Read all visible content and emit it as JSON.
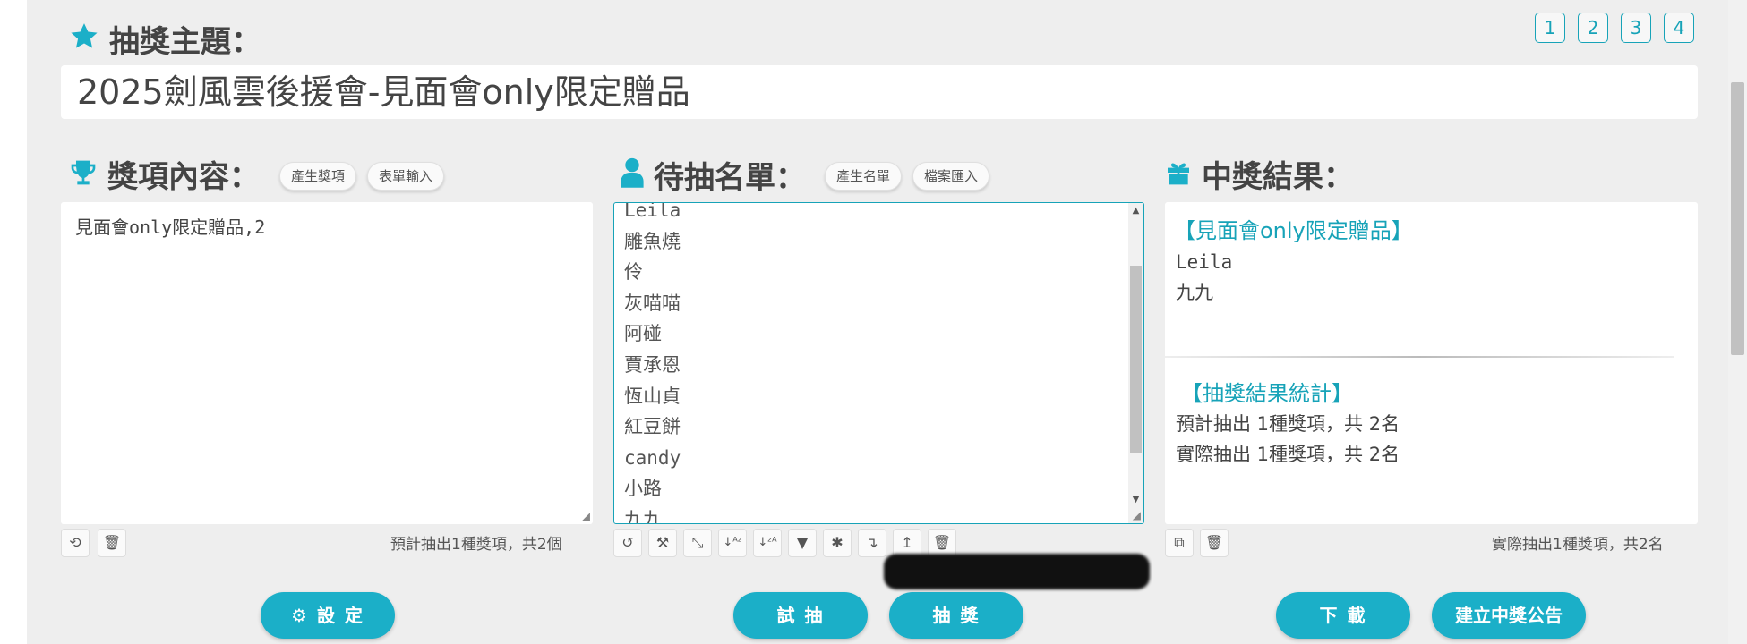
{
  "page_buttons": [
    "1",
    "2",
    "3",
    "4"
  ],
  "topic": {
    "heading": "抽獎主題：",
    "value": "2025劍風雲後援會-見面會only限定贈品"
  },
  "prizes": {
    "heading": "獎項內容：",
    "btn_generate": "產生獎項",
    "btn_form": "表單輸入",
    "content": "見面會only限定贈品,2",
    "summary": "預計抽出1種獎項，共2個"
  },
  "names": {
    "heading": "待抽名單：",
    "btn_generate": "產生名單",
    "btn_import": "檔案匯入",
    "list": [
      "Leila",
      "雕魚燒",
      "伶",
      "灰喵喵",
      "阿碰",
      "賈承恩",
      "恆山貞",
      "紅豆餅",
      "candy",
      "小路",
      "九九"
    ]
  },
  "results": {
    "heading": "中獎結果：",
    "prize_header": "【見面會only限定贈品】",
    "winners": [
      "Leila",
      "九九"
    ],
    "stats_header": "【抽獎結果統計】",
    "expected": "預計抽出 1種獎項，共 2名",
    "actual": "實際抽出 1種獎項，共 2名",
    "summary": "實際抽出1種獎項，共2名"
  },
  "actions": {
    "settings": "設 定",
    "trial": "試 抽",
    "draw": "抽 獎",
    "download": "下 載",
    "announce": "建立中獎公告"
  },
  "colors": {
    "accent": "#1bafc8",
    "background": "#eeeeee"
  },
  "icons": {
    "topic": "star-icon",
    "prizes": "trophy-icon",
    "names": "user-icon",
    "results": "gift-icon"
  }
}
